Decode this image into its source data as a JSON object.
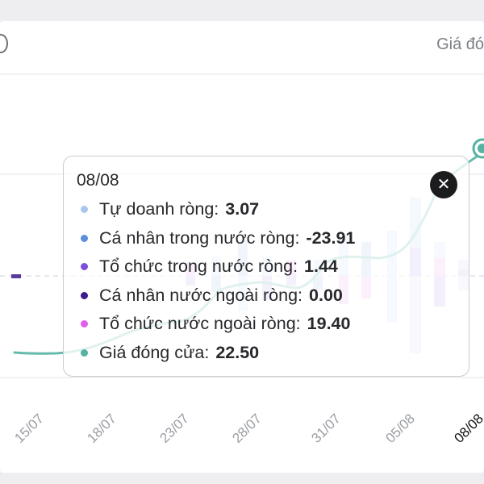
{
  "header": {
    "right_label": "Giá đó"
  },
  "tooltip": {
    "date": "08/08",
    "rows": [
      {
        "label": "Tự doanh ròng:",
        "value": "3.07",
        "color": "#a9c6ee"
      },
      {
        "label": "Cá nhân trong nước ròng:",
        "value": "-23.91",
        "color": "#5b8fdb"
      },
      {
        "label": "Tổ chức trong nước ròng:",
        "value": "1.44",
        "color": "#7c4fdc"
      },
      {
        "label": "Cá nhân nước ngoài ròng:",
        "value": "0.00",
        "color": "#3d1a91"
      },
      {
        "label": "Tổ chức nước ngoài ròng:",
        "value": "19.40",
        "color": "#e35ee9"
      },
      {
        "label": "Giá đóng cửa:",
        "value": "22.50",
        "color": "#55b3a3"
      }
    ],
    "close_symbol": "✕"
  },
  "chart_data": {
    "type": "bar",
    "x_tick_labels": [
      "15/07",
      "18/07",
      "23/07",
      "28/07",
      "31/07",
      "05/08",
      "08/08"
    ],
    "highlighted_date": "08/08",
    "colors": {
      "self_trading": "#a9c6ee",
      "domestic_individual": "#5b8fdb",
      "domestic_institution": "#7c4fdc",
      "foreign_individual": "#3d1a91",
      "foreign_institution": "#e35ee9",
      "close_price": "#55b3a3"
    },
    "close_price_highlight": 22.5
  }
}
